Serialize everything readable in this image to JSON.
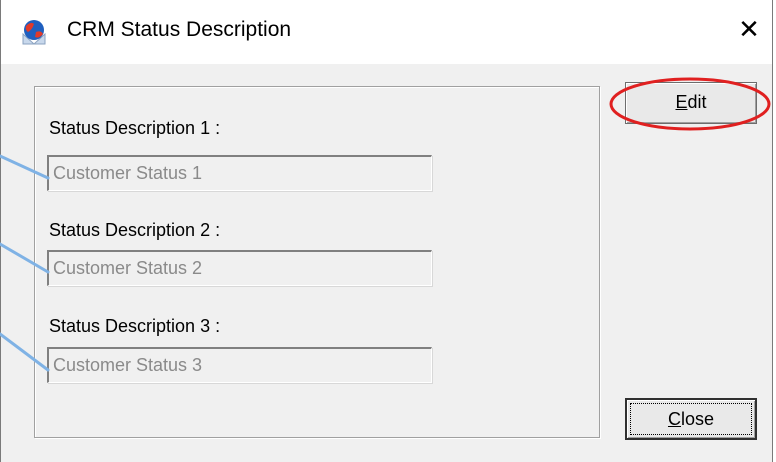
{
  "window": {
    "title": "CRM Status Description",
    "close_glyph": "✕",
    "icon": "app-globe-icon"
  },
  "form": {
    "fields": [
      {
        "label": "Status Description 1 :",
        "value": "Customer Status 1"
      },
      {
        "label": "Status Description 2 :",
        "value": "Customer Status 2"
      },
      {
        "label": "Status Description 3 :",
        "value": "Customer Status 3"
      }
    ]
  },
  "buttons": {
    "edit_prefix": "E",
    "edit_rest": "dit",
    "close_prefix": "C",
    "close_rest": "lose"
  },
  "annotations": {
    "callout_line_color": "#7fb2e5",
    "highlight_circle_color": "#e02020"
  }
}
